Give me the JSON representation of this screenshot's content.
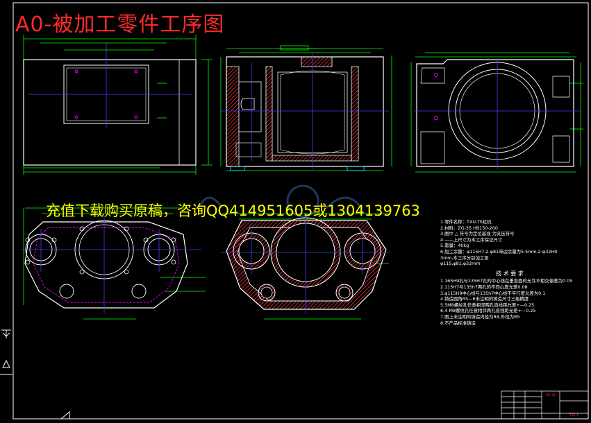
{
  "title": "A0-被加工零件工序图",
  "watermark": "充值下载购买原稿，咨询QQ414951605或1304139763",
  "colors": {
    "background": "#000000",
    "frame": "#ffffff",
    "outline": "#ffffff",
    "hatch": "#ff4040",
    "dimension": "#00ff00",
    "center": "#4040ff",
    "title": "#ff2a2a",
    "watermark": "#ffff00",
    "magenta": "#ff00ff",
    "cyan": "#00ffff"
  },
  "notes": {
    "lines": [
      "1.零件名称：TXU-TS缸机",
      "2.材料：ZG-35  HB150-200",
      "3.图中  △    符号为定位基准     为夹压符号",
      "4.——上尺寸为本工序保证尺寸",
      "5.重量：40kg",
      "6.加工余量：φ115H7,2-φ81单边余量为5.5mm,2-φ32H9",
      "                    3mm,本工序分别加工至",
      "φ115,φ81,φ32mm"
    ],
    "tech_title": "技 术 要 求",
    "tech_lines": [
      "1.165H9孔与135H7孔的中心线在垂直面的允许不相交偏差为0.05",
      "2.115H7与135h7两孔的不同心度允差0.08",
      "3.φ115H9中心线与135h7中心线不平行度允差为0.1",
      "4.铸造圆角R5—6未注明的铸造尺寸三级精度",
      "5.5M8螺纹孔任意相邻两孔直线距允差+—0.25",
      "6.4-M8螺纹孔任意相邻两孔直线距允差+—0.25",
      "7.图上未注明的铸造内径为R8,外径为R5",
      "8.不产品标准铸造"
    ]
  },
  "title_block": {
    "material": "ZG-35",
    "drawing_no": "TSE-1"
  }
}
